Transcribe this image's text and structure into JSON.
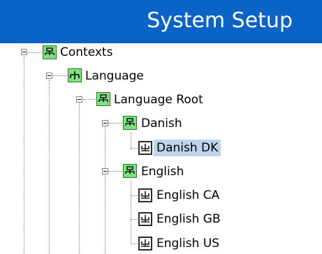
{
  "header": {
    "title": "System Setup"
  },
  "tree": {
    "items": [
      {
        "label": "Contexts",
        "icon": "context-node-icon",
        "expanded": true
      },
      {
        "label": "Language",
        "icon": "context-node-icon",
        "expanded": true
      },
      {
        "label": "Language Root",
        "icon": "context-node-icon",
        "expanded": true
      },
      {
        "label": "Danish",
        "icon": "context-node-icon",
        "expanded": true
      },
      {
        "label": "Danish DK",
        "icon": "locale-leaf-icon",
        "selected": true
      },
      {
        "label": "English",
        "icon": "context-node-icon",
        "expanded": true
      },
      {
        "label": "English CA",
        "icon": "locale-leaf-icon"
      },
      {
        "label": "English GB",
        "icon": "locale-leaf-icon"
      },
      {
        "label": "English US",
        "icon": "locale-leaf-icon"
      }
    ]
  },
  "colors": {
    "header_bg": "#0a64c8",
    "selection": "#bcd4ee",
    "context_icon": "#7ee07e"
  }
}
